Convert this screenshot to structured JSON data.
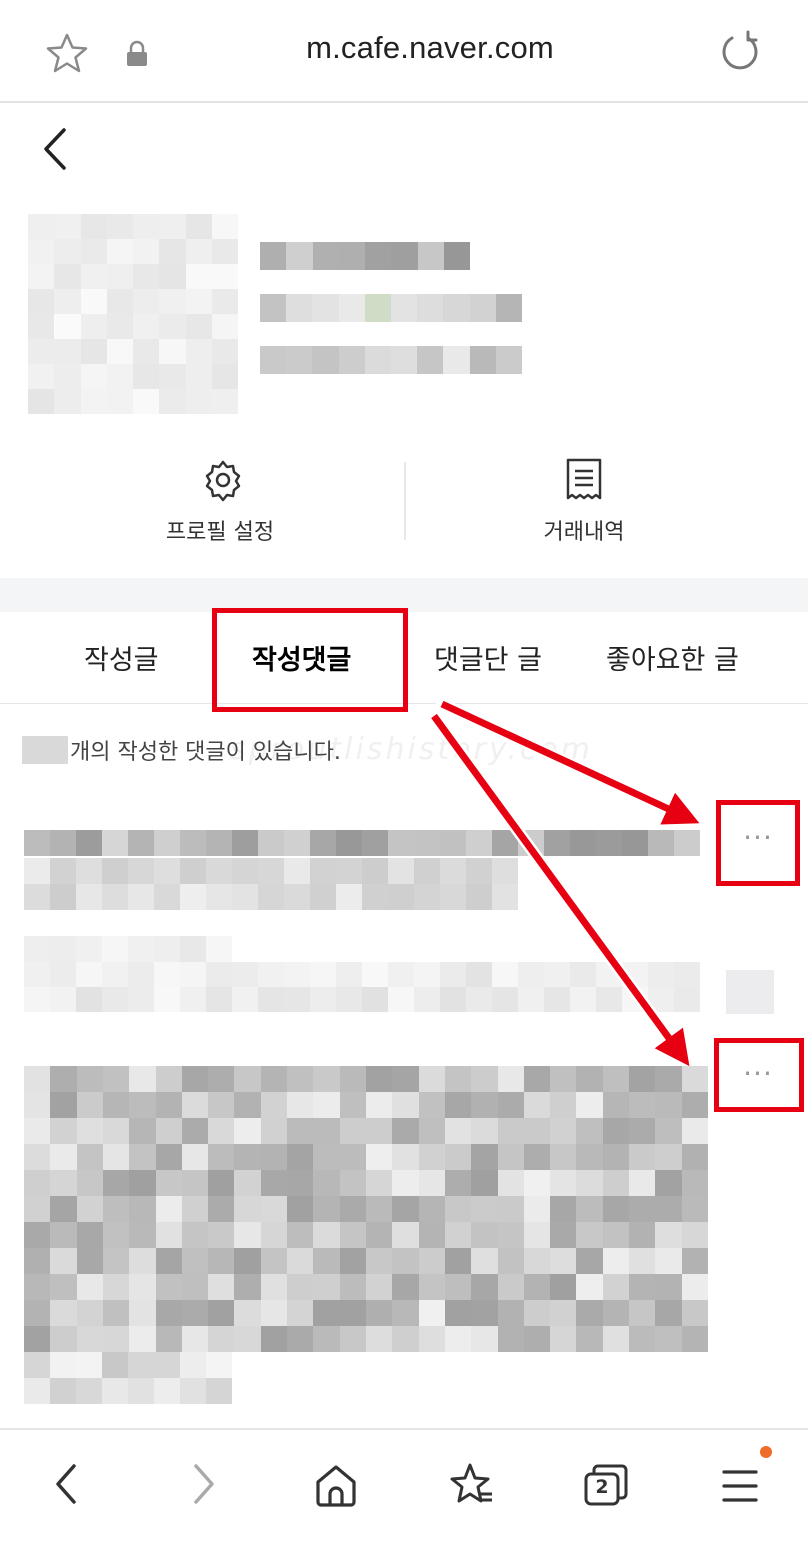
{
  "browser": {
    "url": "m.cafe.naver.com",
    "icons": [
      "star-icon",
      "lock-icon",
      "reload-icon"
    ]
  },
  "profile": {
    "actions": [
      {
        "label": "프로필 설정",
        "icon": "gear-icon"
      },
      {
        "label": "거래내역",
        "icon": "receipt-icon"
      }
    ]
  },
  "tabs": [
    {
      "label": "작성글",
      "active": false
    },
    {
      "label": "작성댓글",
      "active": true
    },
    {
      "label": "댓글단 글",
      "active": false
    },
    {
      "label": "좋아요한 글",
      "active": false
    }
  ],
  "comments": {
    "count_text": "개의 작성한 댓글이 있습니다.",
    "more_label": "···",
    "watermark": "sproutlishistory.com"
  },
  "bottom_nav": {
    "items": [
      "back-icon",
      "forward-icon",
      "home-icon",
      "bookmarks-icon",
      "tabs-icon",
      "menu-icon"
    ],
    "tab_count": "2"
  },
  "annotation_color": "#e60012"
}
